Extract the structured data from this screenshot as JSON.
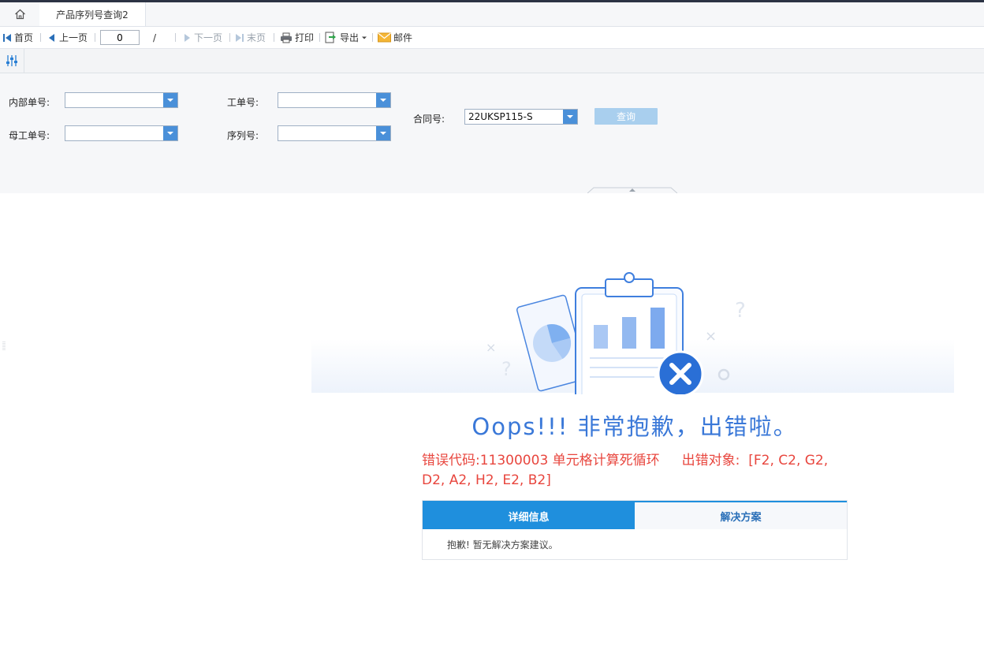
{
  "tabs": {
    "home_icon": "home-icon",
    "report_tab_label": "产品序列号查询2"
  },
  "toolbar": {
    "first": "首页",
    "prev": "上一页",
    "page_value": "0",
    "page_separator": "/",
    "next": "下一页",
    "last": "末页",
    "print": "打印",
    "export": "导出",
    "mail": "邮件"
  },
  "params": {
    "inner_no_label": "内部单号:",
    "inner_no_value": "",
    "parent_wo_label": "母工单号:",
    "parent_wo_value": "",
    "wo_label": "工单号:",
    "wo_value": "",
    "serial_label": "序列号:",
    "serial_value": "",
    "contract_label": "合同号:",
    "contract_value": "22UKSP115-S",
    "query_button": "查询"
  },
  "error": {
    "title": "Oops!!! 非常抱歉，出错啦。",
    "code_text": "错误代码:11300003 单元格计算死循环",
    "object_label": "出错对象:",
    "object_value": "[F2, C2, G2, D2, A2, H2, E2, B2]"
  },
  "info": {
    "tab_detail": "详细信息",
    "tab_solution": "解决方案",
    "content": "抱歉! 暂无解决方案建议。"
  },
  "colors": {
    "accent": "#1f8fdd",
    "error": "#e8463e",
    "title": "#3a78d8"
  }
}
